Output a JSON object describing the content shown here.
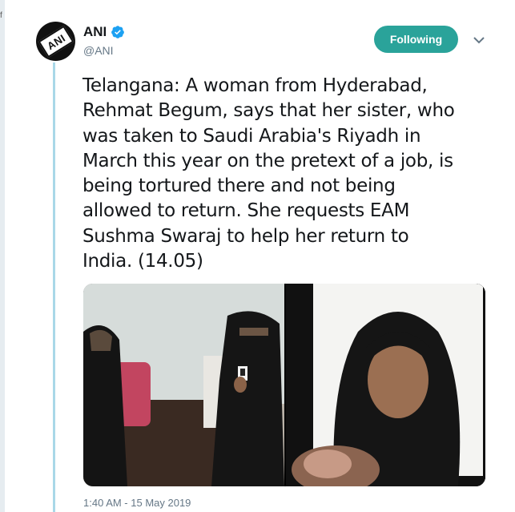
{
  "tweet": {
    "author": {
      "display_name": "ANI",
      "handle": "@ANI",
      "avatar_text": "ANI",
      "verified": true
    },
    "follow_button": "Following",
    "menu_icon": "chevron-down-icon",
    "text_lines": [
      "Telangana: A woman from Hyderabad,",
      "Rehmat Begum, says that her sister, who",
      "was taken to Saudi Arabia's Riyadh in",
      "March this year on the pretext of a job, is",
      "being tortured there and not being",
      "allowed to return. She requests EAM",
      "Sushma Swaraj to help her return to",
      "India. (14.05)"
    ],
    "timestamp": "1:40 AM - 15 May 2019"
  },
  "colors": {
    "follow_button": "#2aa39a",
    "verified": "#1da1f2",
    "thread_line": "#a9d8e8",
    "secondary_text": "#657786"
  }
}
